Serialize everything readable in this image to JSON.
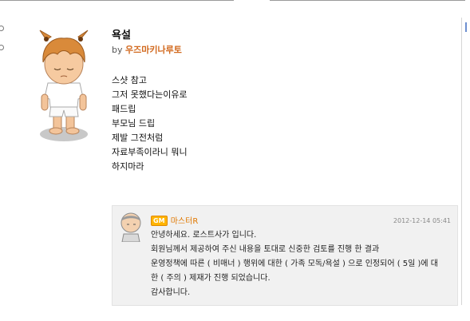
{
  "post": {
    "title": "욕설",
    "by_label": "by",
    "author": "우즈마키나루토",
    "body": [
      "스샷 참고",
      "그저 못했다는이유로",
      "패드립",
      "부모님 드립",
      "제발 그전처럼",
      "자료부족이라니 뭐니",
      "하지마라"
    ]
  },
  "comment": {
    "badge": "GM",
    "author": "마스터R",
    "date": "2012-12-14 05:41",
    "lines": [
      "안녕하세요. 로스트사가 입니다.",
      "회원님께서 제공하여 주신 내용을 토대로 신중한 검토를 진행 한 결과",
      "운영정책에 따른 ( 비매너 ) 행위에 대한 ( 가족 모독/욕설 ) 으로 인정되어 ( 5일 )에 대",
      "한 ( 주의 ) 제재가 진행 되었습니다.",
      "감사합니다."
    ]
  },
  "colors": {
    "author": "#d2691e",
    "gm_badge": "#ffb400",
    "comment_bg": "#f1f1f1"
  },
  "icons": {
    "post_avatar": "character-avatar-icon",
    "comment_avatar": "gm-avatar-icon"
  }
}
